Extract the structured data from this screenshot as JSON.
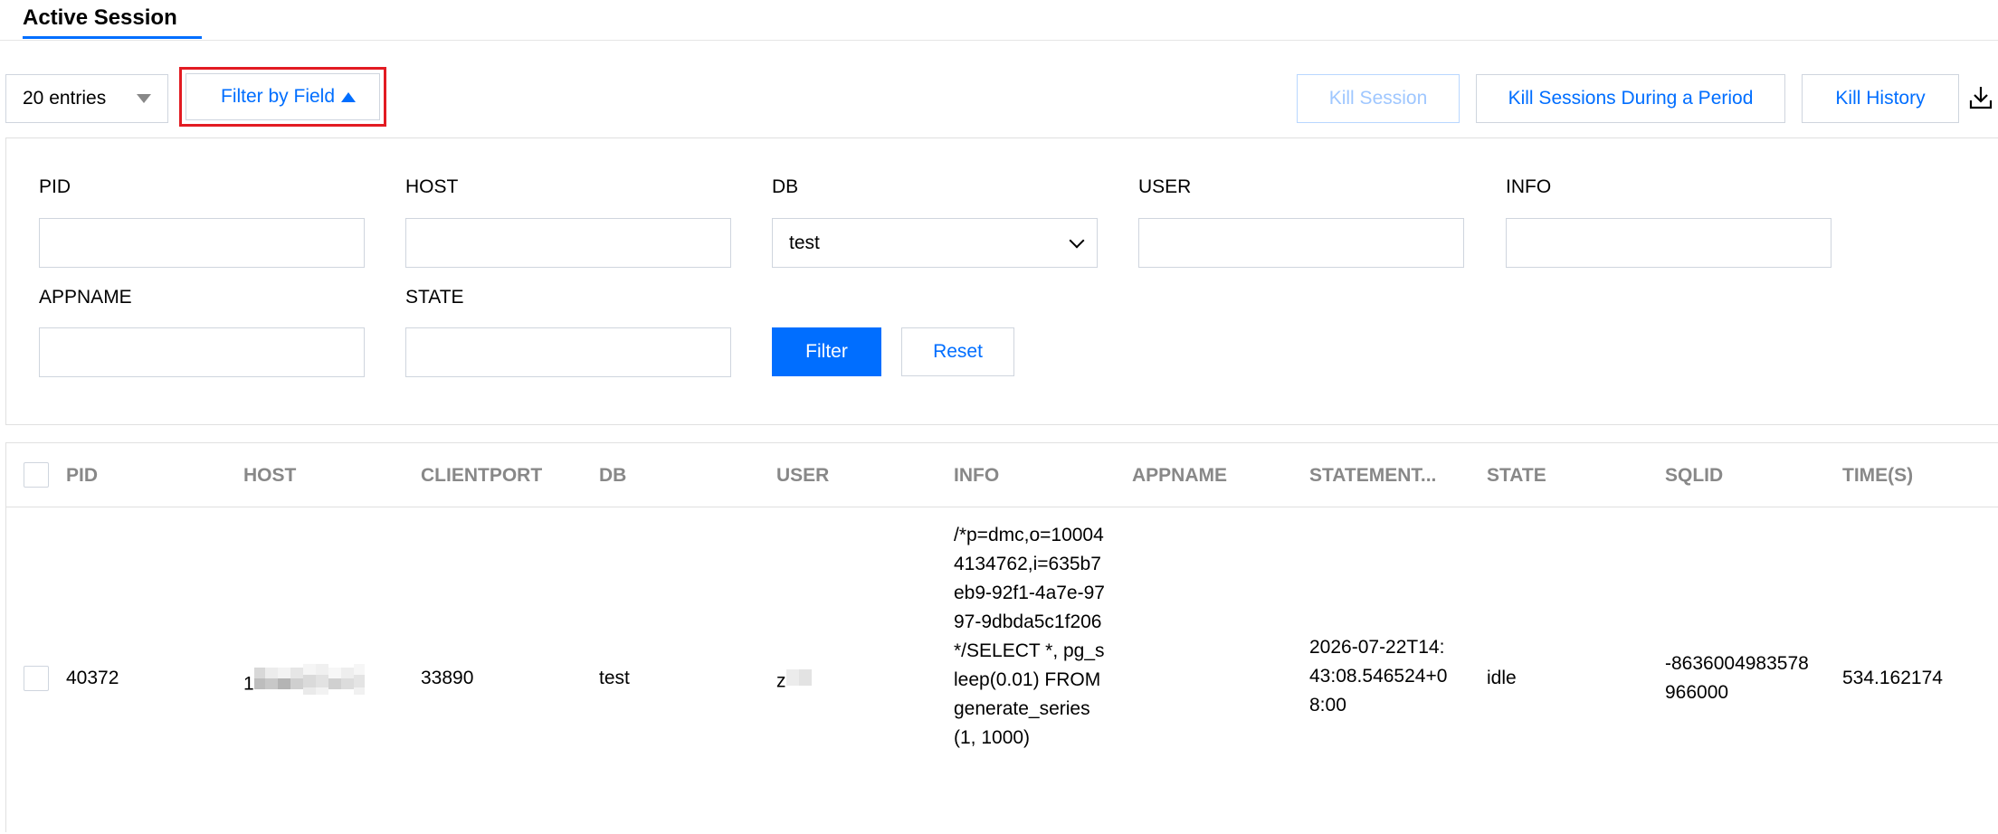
{
  "tab": {
    "label": "Active Session"
  },
  "toolbar": {
    "entries_label": "20 entries",
    "filter_toggle_label": "Filter by Field",
    "kill_session_label": "Kill Session",
    "kill_period_label": "Kill Sessions During a Period",
    "kill_history_label": "Kill History"
  },
  "filters": {
    "pid": {
      "label": "PID",
      "value": ""
    },
    "host": {
      "label": "HOST",
      "value": ""
    },
    "db": {
      "label": "DB",
      "value": "test"
    },
    "user": {
      "label": "USER",
      "value": ""
    },
    "info": {
      "label": "INFO",
      "value": ""
    },
    "appname": {
      "label": "APPNAME",
      "value": ""
    },
    "state": {
      "label": "STATE",
      "value": ""
    },
    "filter_button": "Filter",
    "reset_button": "Reset"
  },
  "table": {
    "columns": [
      "PID",
      "HOST",
      "CLIENTPORT",
      "DB",
      "USER",
      "INFO",
      "APPNAME",
      "STATEMENT...",
      "STATE",
      "SQLID",
      "TIME(S)"
    ],
    "rows": [
      {
        "pid": "40372",
        "host": "1",
        "clientport": "33890",
        "db": "test",
        "user": "z",
        "info": "/*p=dmc,o=100044134762,i=635b7eb9-92f1-4a7e-9797-9dbda5c1f206*/SELECT *, pg_sleep(0.01) FROM generate_series(1, 1000)",
        "appname": "",
        "statement": "2026-07-22T14:43:08.546524+08:00",
        "state": "idle",
        "sqlid": "-8636004983578966000",
        "time": "534.162174"
      }
    ]
  },
  "colors": {
    "accent": "#006eff",
    "highlight_border": "#e21b22",
    "header_text": "#888888"
  }
}
